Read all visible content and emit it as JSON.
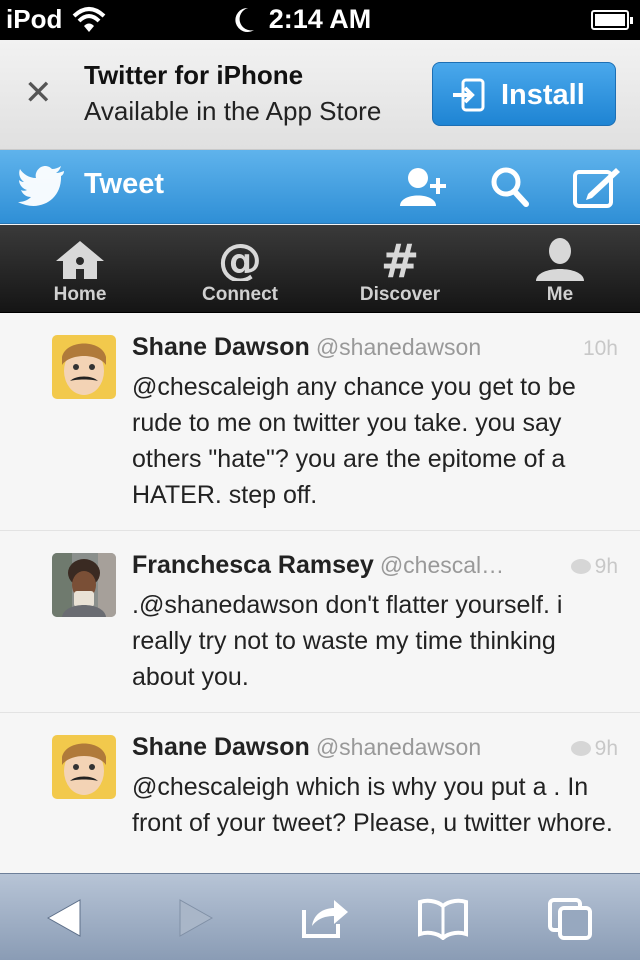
{
  "status_bar": {
    "carrier": "iPod",
    "time": "2:14 AM"
  },
  "banner": {
    "title": "Twitter for iPhone",
    "subtitle": "Available in the App Store",
    "install_label": "Install"
  },
  "header": {
    "title": "Tweet"
  },
  "nav": {
    "tabs": [
      {
        "label": "Home",
        "icon": "home-icon"
      },
      {
        "label": "Connect",
        "icon": "at-icon"
      },
      {
        "label": "Discover",
        "icon": "hash-icon"
      },
      {
        "label": "Me",
        "icon": "person-icon"
      }
    ]
  },
  "tweets": [
    {
      "name": "Shane Dawson",
      "handle": "@shanedawson",
      "time": "10h",
      "text": "@chescaleigh any chance you get to be rude to me on twitter you take. you say others \"hate\"? you are the epitome of a HATER. step off."
    },
    {
      "name": "Franchesca Ramsey",
      "handle": "@chescal…",
      "time": "9h",
      "text": ".@shanedawson don't flatter yourself. i really try not to waste my time thinking about you."
    },
    {
      "name": "Shane Dawson",
      "handle": "@shanedawson",
      "time": "9h",
      "text": "@chescaleigh which is why you put a . In front of your tweet? Please, u twitter whore."
    }
  ],
  "colors": {
    "twitter_blue": "#3a9ae0",
    "nav_dark": "#1e1e1e",
    "toolbar": "#9fb0c6"
  }
}
